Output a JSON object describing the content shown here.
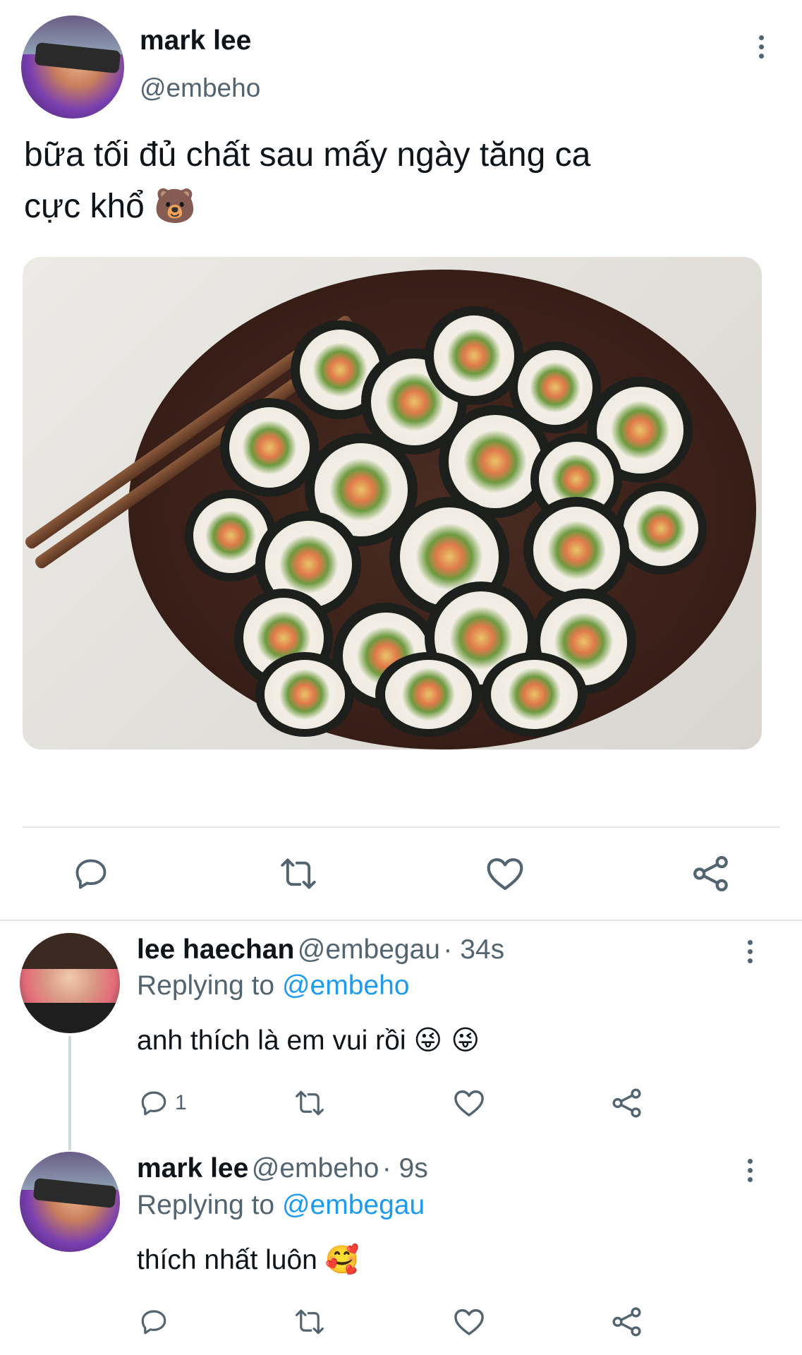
{
  "main_tweet": {
    "author_name": "mark lee",
    "author_handle": "@embeho",
    "text_line1": "bữa tối đủ chất sau mấy ngày tăng ca",
    "text_line2": "cực khổ",
    "text_emoji": "🐻",
    "image_alt": "plate of kimbap with chopsticks"
  },
  "actions": {
    "reply_icon": "reply-icon",
    "retweet_icon": "retweet-icon",
    "like_icon": "heart-icon",
    "share_icon": "share-icon"
  },
  "replies": [
    {
      "author_name": "lee haechan",
      "author_handle": "@embegau",
      "time": "· 34s",
      "replying_prefix": "Replying to",
      "replying_to": "@embeho",
      "text": "anh thích là em vui rồi",
      "emoji": "😜 😜",
      "reply_count": "1"
    },
    {
      "author_name": "mark lee",
      "author_handle": "@embeho",
      "time": "· 9s",
      "replying_prefix": "Replying to",
      "replying_to": "@embegau",
      "text": "thích nhất luôn",
      "emoji": "🥰",
      "reply_count": ""
    }
  ],
  "colors": {
    "accent": "#1d9bf0",
    "text": "#0f1419",
    "secondary": "#536471",
    "divider": "#e1e6ea"
  }
}
